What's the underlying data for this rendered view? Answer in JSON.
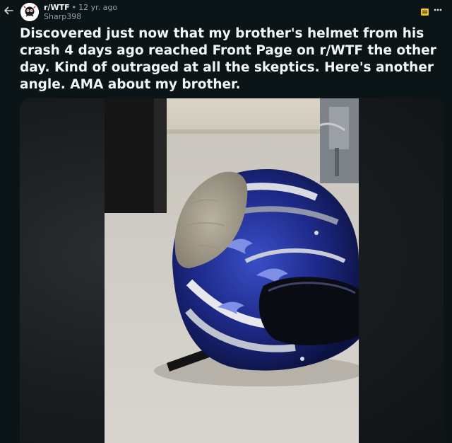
{
  "post": {
    "subreddit": "r/WTF",
    "separator": "•",
    "age": "12 yr. ago",
    "author": "Sharp398",
    "title": "Discovered just now that my brother's helmet from his crash 4 days ago reached Front Page on r/WTF the other day. Kind of outraged at all the skeptics. Here's another angle. AMA about my brother."
  },
  "icons": {
    "back": "back-arrow-icon",
    "avatar": "subreddit-avatar-icon",
    "badge": "award-badge-icon",
    "more": "more-options-icon"
  },
  "colors": {
    "background": "#0b1416",
    "text": "#f2f4f5",
    "muted": "#8ba2ad",
    "badge": "#f5c518"
  }
}
